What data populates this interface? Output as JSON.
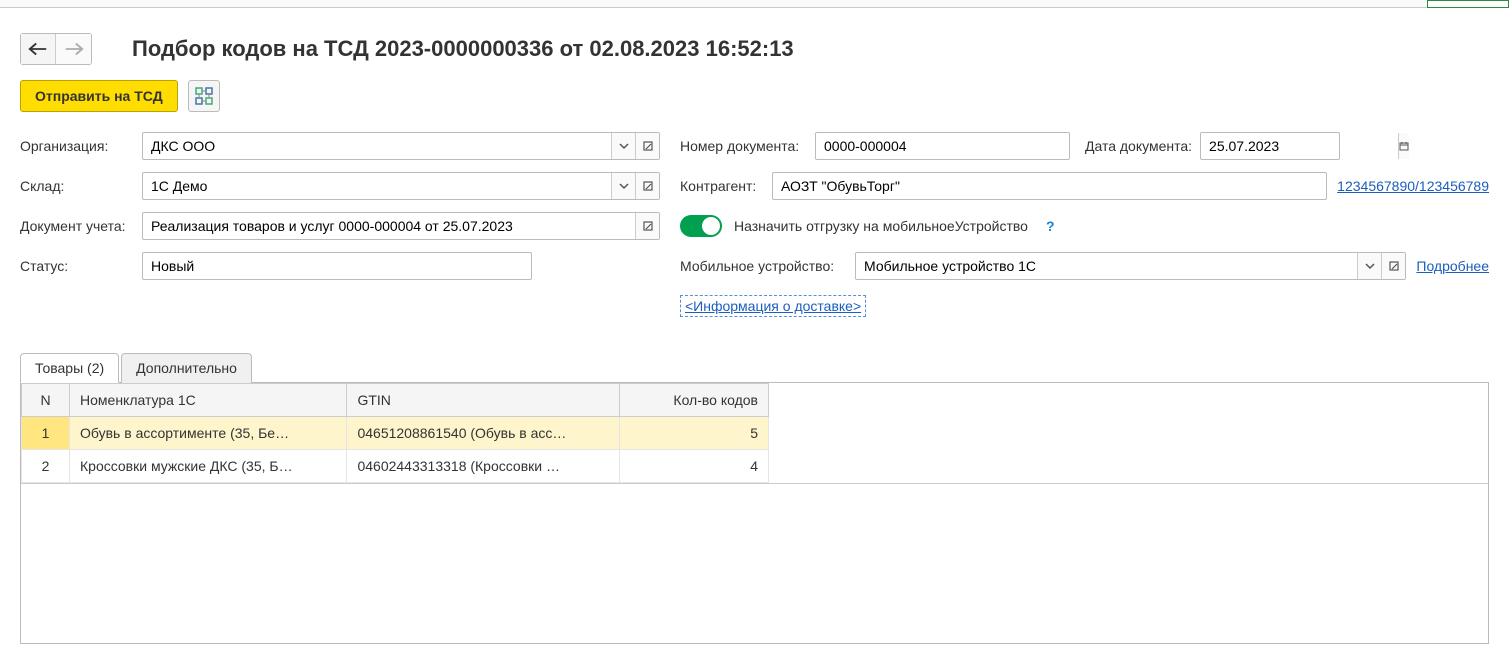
{
  "title": "Подбор кодов на ТСД 2023-0000000336 от 02.08.2023 16:52:13",
  "toolbar": {
    "send_label": "Отправить на ТСД"
  },
  "labels": {
    "org": "Организация:",
    "warehouse": "Склад:",
    "doc": "Документ учета:",
    "status": "Статус:",
    "doc_num": "Номер документа:",
    "doc_date": "Дата документа:",
    "partner": "Контрагент:",
    "assign_toggle": "Назначить отгрузку на мобильноеУстройство",
    "mobile": "Мобильное устройство:",
    "more_link": "Подробнее",
    "delivery_info": "<Информация о доставке>"
  },
  "fields": {
    "org": "ДКС ООО",
    "warehouse": "1С Демо",
    "doc": "Реализация товаров и услуг 0000-000004 от 25.07.2023",
    "status": "Новый",
    "doc_num": "0000-000004",
    "doc_date": "25.07.2023",
    "partner": "АОЗТ \"ОбувьТорг\"",
    "partner_link": "1234567890/123456789",
    "mobile": "Мобильное устройство 1С"
  },
  "tabs": {
    "goods": "Товары (2)",
    "additional": "Дополнительно"
  },
  "table": {
    "headers": {
      "n": "N",
      "item": "Номенклатура 1С",
      "gtin": "GTIN",
      "qty": "Кол-во кодов"
    },
    "rows": [
      {
        "n": "1",
        "item": "Обувь в ассортименте (35, Бе…",
        "gtin": "04651208861540 (Обувь в асс…",
        "qty": "5"
      },
      {
        "n": "2",
        "item": "Кроссовки мужские ДКС (35, Б…",
        "gtin": "04602443313318 (Кроссовки …",
        "qty": "4"
      }
    ]
  }
}
